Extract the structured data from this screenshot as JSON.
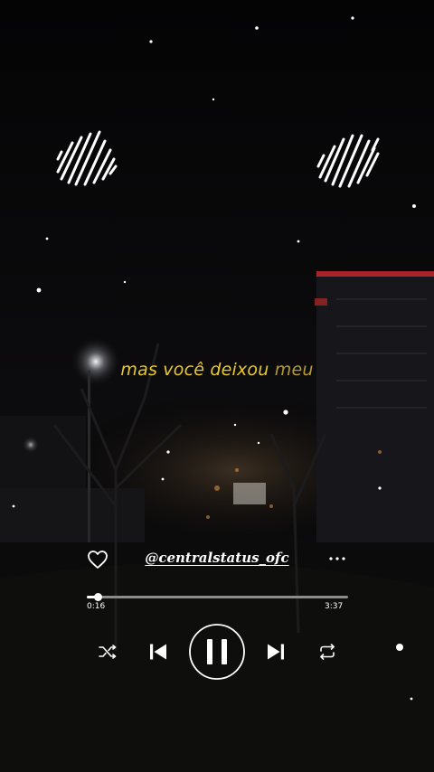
{
  "lyric": {
    "sung_words": "mas você deixou",
    "unsung_words": "meu"
  },
  "player": {
    "handle": "@centralstatus_ofc",
    "elapsed": "0:16",
    "total": "3:37",
    "progress": 0.04
  },
  "icons": {
    "like": "heart-icon",
    "more": "more-icon",
    "shuffle": "shuffle-icon",
    "previous": "skip-previous-icon",
    "pause": "pause-icon",
    "next": "skip-next-icon",
    "repeat": "repeat-icon",
    "decoration": "sound-wave-icon"
  },
  "colors": {
    "lyric_sung": "#e8c92a",
    "lyric_unsung": "#b49a34",
    "controls": "#ffffff",
    "track": "#8c8c8c"
  }
}
